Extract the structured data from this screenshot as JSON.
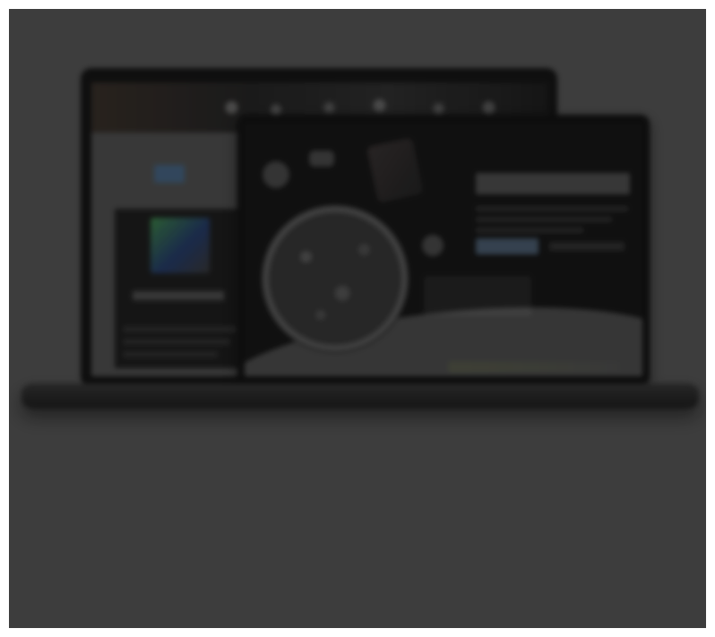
{
  "image": {
    "kind": "blurred device mockup",
    "description": ""
  }
}
